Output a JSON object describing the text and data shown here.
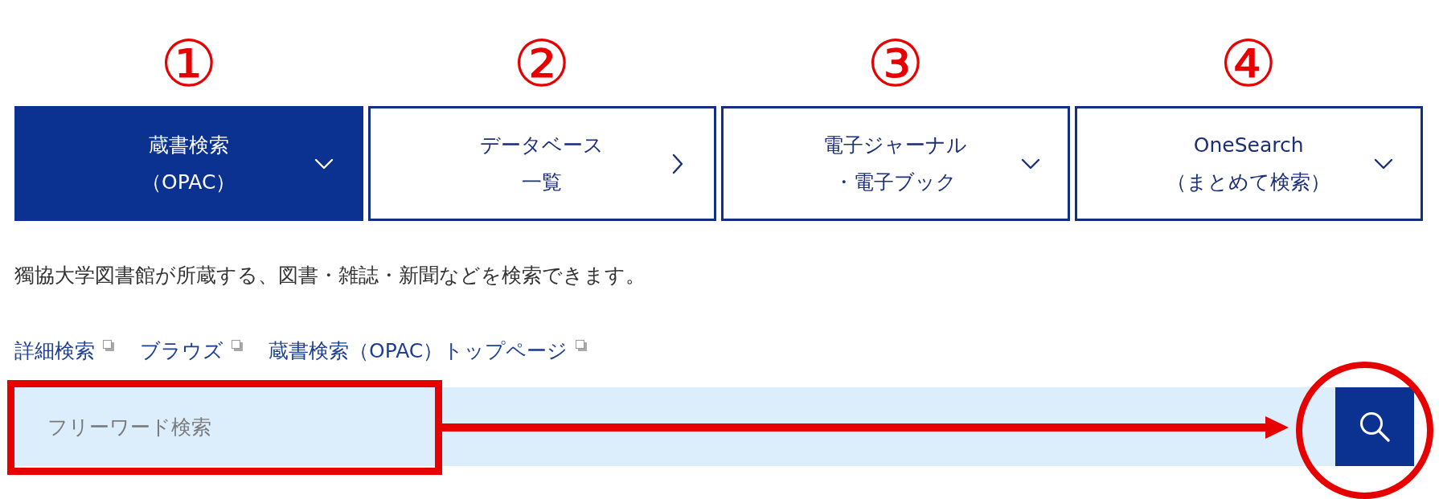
{
  "tabs": [
    {
      "marker": "①",
      "lines": [
        "蔵書検索",
        "（OPAC）"
      ],
      "kind": "dropdown",
      "selected": true
    },
    {
      "marker": "②",
      "lines": [
        "データベース",
        "一覧"
      ],
      "kind": "link",
      "selected": false
    },
    {
      "marker": "③",
      "lines": [
        "電子ジャーナル",
        "・電子ブック"
      ],
      "kind": "dropdown",
      "selected": false
    },
    {
      "marker": "④",
      "lines": [
        "OneSearch",
        "（まとめて検索）"
      ],
      "kind": "dropdown",
      "selected": false
    }
  ],
  "description": "獨協大学図書館が所蔵する、図書・雑誌・新聞などを検索できます。",
  "links": [
    {
      "label": "詳細検索",
      "external": true
    },
    {
      "label": "ブラウズ",
      "external": true
    },
    {
      "label": "蔵書検索（OPAC）トップページ",
      "external": true
    }
  ],
  "search": {
    "placeholder": "フリーワード検索"
  },
  "annotations": [
    {
      "kind": "box"
    },
    {
      "kind": "arrow"
    },
    {
      "kind": "circle"
    }
  ]
}
